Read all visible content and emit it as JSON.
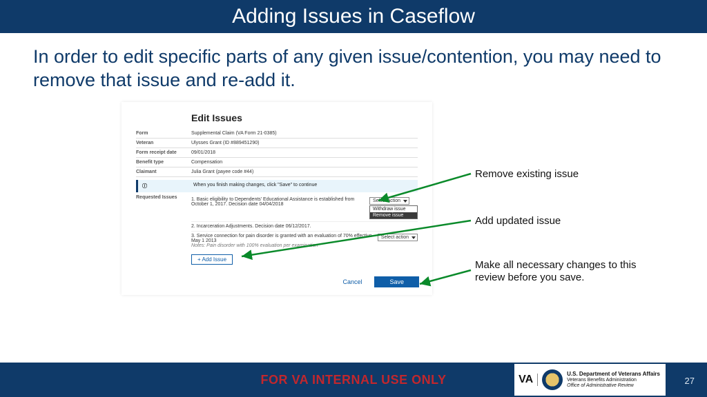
{
  "title": "Adding Issues in Caseflow",
  "intro": "In order to edit specific parts of any given issue/contention, you may need to remove that issue and re-add it.",
  "screenshot": {
    "heading": "Edit Issues",
    "rows": {
      "form_label": "Form",
      "form_value": "Supplemental Claim (VA Form 21-0385)",
      "veteran_label": "Veteran",
      "veteran_value": "Ulysses Grant (ID #889451290)",
      "receipt_label": "Form receipt date",
      "receipt_value": "09/01/2018",
      "benefit_label": "Benefit type",
      "benefit_value": "Compensation",
      "claimant_label": "Claimant",
      "claimant_value": "Julia Grant (payee code #44)"
    },
    "info_icon": "ⓘ",
    "info_text": "When you finish making changes, click \"Save\" to continue",
    "requested_label": "Requested Issues",
    "issues": [
      {
        "text": "1. Basic eligibility to Dependents' Educational Assistance is established from October 1, 2017. Decision date 04/04/2018",
        "select_label": "Select action",
        "dropdown": {
          "opt1": "Withdraw issue",
          "opt2": "Remove issue"
        }
      },
      {
        "text": "2. Incarceration Adjustments. Decision date 06/12/2017."
      },
      {
        "text": "3. Service connection for pain disorder is granted with an evaluation of 70% effective May 1 2013",
        "note": "Notes: Pain disorder with 100% evaluation per examination",
        "select_label": "Select action"
      }
    ],
    "add_issue": "+ Add Issue",
    "cancel": "Cancel",
    "save": "Save"
  },
  "callouts": {
    "remove": "Remove existing issue",
    "add": "Add updated issue",
    "save": "Make all necessary changes to this review before you save."
  },
  "footer": {
    "internal": "FOR VA INTERNAL USE ONLY",
    "page": "27",
    "va": "VA",
    "dept": "U.S. Department of Veterans Affairs",
    "line2": "Veterans Benefits Administration",
    "line3": "Office of Administrative Review"
  }
}
